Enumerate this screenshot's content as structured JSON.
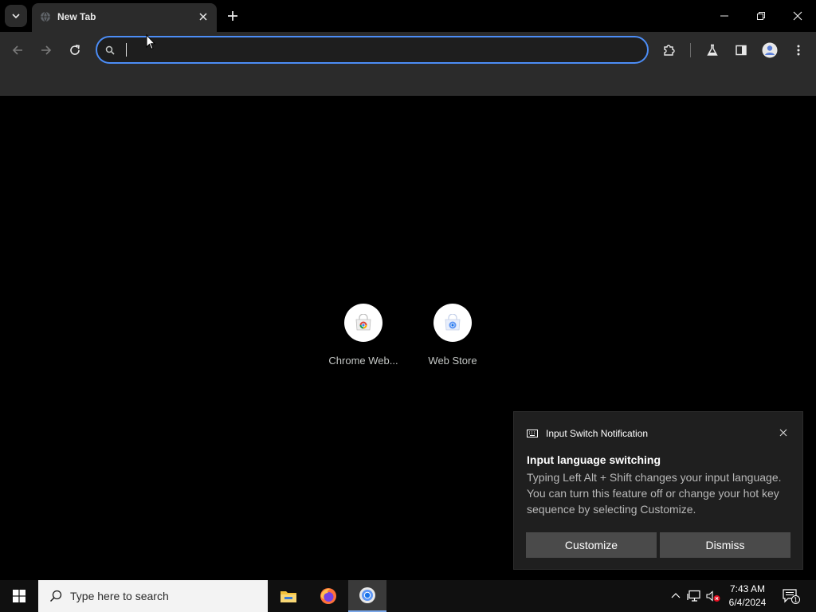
{
  "browser": {
    "tab_title": "New Tab",
    "omnibox_value": "",
    "omnibox_placeholder": ""
  },
  "shortcuts": [
    {
      "label": "Chrome Web...",
      "icon": "chrome-web-store-icon"
    },
    {
      "label": "Web Store",
      "icon": "web-store-icon"
    }
  ],
  "notification": {
    "app_name": "Input Switch Notification",
    "title": "Input language switching",
    "body": "Typing Left Alt + Shift changes your input language. You can turn this feature off or change your hot key sequence by selecting Customize.",
    "customize_label": "Customize",
    "dismiss_label": "Dismiss"
  },
  "taskbar": {
    "search_placeholder": "Type here to search",
    "time": "7:43 AM",
    "date": "6/4/2024",
    "notification_count": "1"
  },
  "colors": {
    "accent": "#4c8df6",
    "toolbar_bg": "#2b2b2b",
    "page_bg": "#000000",
    "toast_bg": "#1f1f1f"
  }
}
